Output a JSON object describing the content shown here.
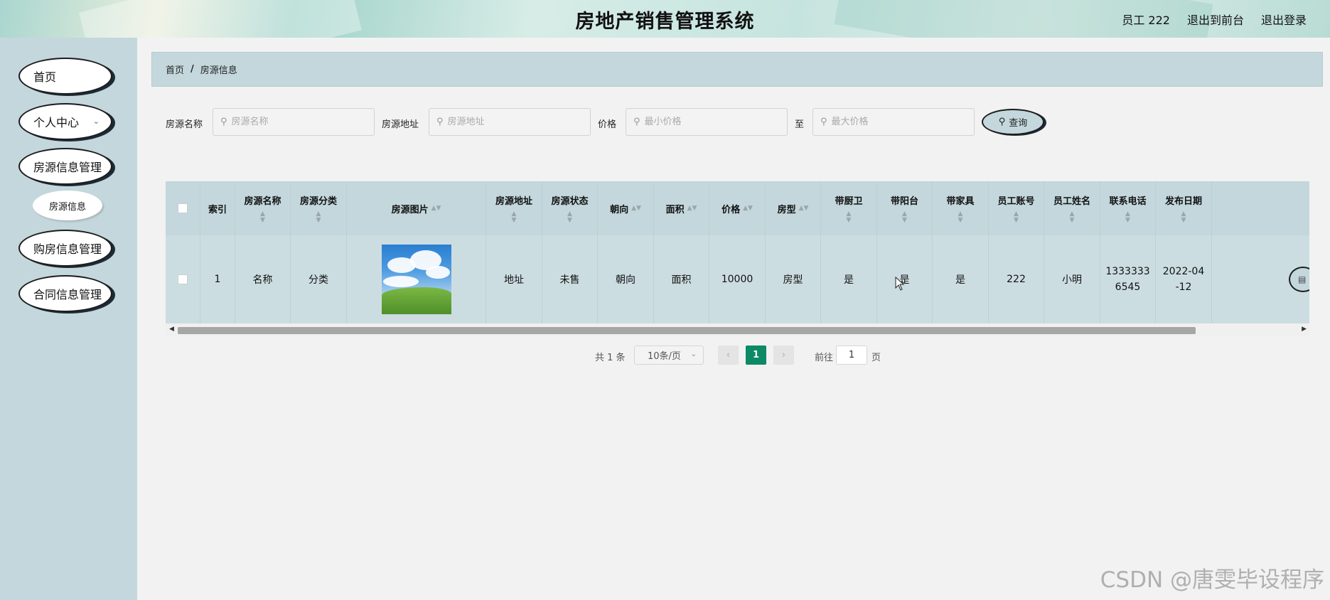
{
  "header": {
    "title": "房地产销售管理系统",
    "user_label": "员工 222",
    "back_to_front": "退出到前台",
    "logout": "退出登录"
  },
  "sidebar": {
    "items": [
      {
        "label": "首页"
      },
      {
        "label": "个人中心",
        "has_children": true
      },
      {
        "label": "房源信息管理"
      },
      {
        "label": "房源信息",
        "sub": true
      },
      {
        "label": "购房信息管理"
      },
      {
        "label": "合同信息管理"
      }
    ]
  },
  "breadcrumb": {
    "home": "首页",
    "separator": "/",
    "current": "房源信息"
  },
  "search": {
    "name_label": "房源名称",
    "name_placeholder": "房源名称",
    "address_label": "房源地址",
    "address_placeholder": "房源地址",
    "price_label": "价格",
    "min_price_placeholder": "最小价格",
    "to_label": "至",
    "max_price_placeholder": "最大价格",
    "query_button": "查询"
  },
  "table": {
    "columns": [
      "索引",
      "房源名称",
      "房源分类",
      "房源图片",
      "房源地址",
      "房源状态",
      "朝向",
      "面积",
      "价格",
      "房型",
      "带厨卫",
      "带阳台",
      "带家具",
      "员工账号",
      "员工姓名",
      "联系电话",
      "发布日期"
    ],
    "rows": [
      {
        "index": "1",
        "name": "名称",
        "category": "分类",
        "address": "地址",
        "status": "未售",
        "orientation": "朝向",
        "area": "面积",
        "price": "10000",
        "layout": "房型",
        "kitchen_bath": "是",
        "balcony": "是",
        "furniture": "是",
        "staff_account": "222",
        "staff_name": "小明",
        "phone_line1": "1333333",
        "phone_line2": "6545",
        "date_line1": "2022-04",
        "date_line2": "-12"
      }
    ]
  },
  "pagination": {
    "total": "共 1 条",
    "page_size": "10条/页",
    "current_page": "1",
    "goto_label": "前往",
    "goto_value": "1",
    "page_suffix": "页"
  },
  "watermark": "CSDN @唐雯毕设程序",
  "colors": {
    "sidebar_bg": "#c3d7dc",
    "page_bg": "#f2f2f2",
    "pager_active": "#0c8a66"
  }
}
